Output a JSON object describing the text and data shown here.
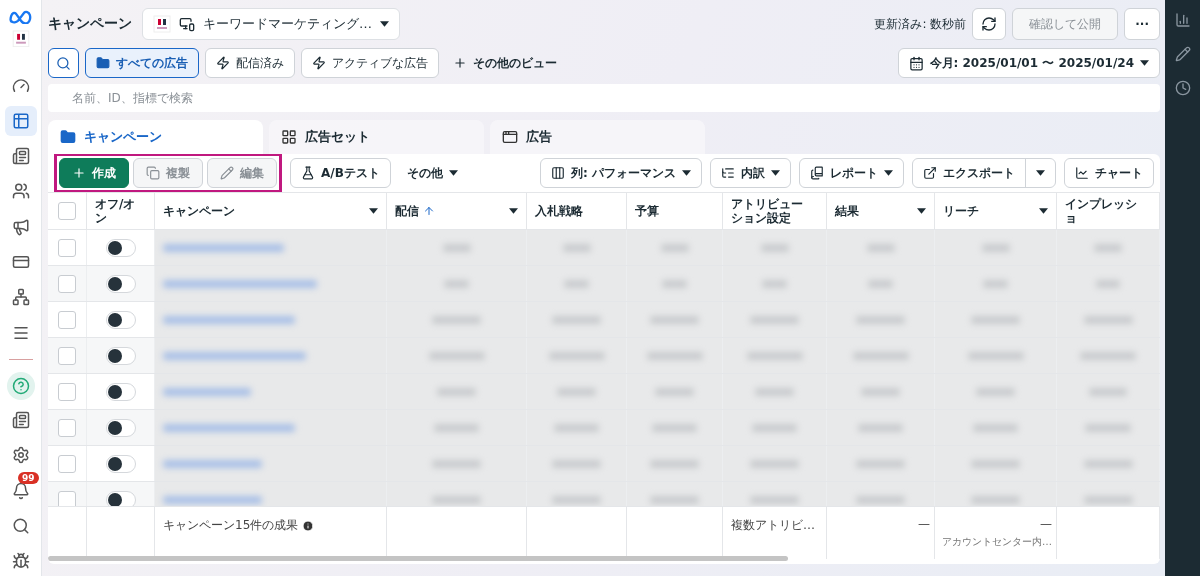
{
  "nav": {
    "items": [
      {
        "selected": false
      },
      {
        "selected": true
      },
      {
        "selected": false
      },
      {
        "selected": false
      },
      {
        "selected": false
      },
      {
        "selected": false
      },
      {
        "selected": false
      },
      {
        "selected": false
      }
    ],
    "bottom": [
      {
        "selected": false
      },
      {
        "selected": false
      },
      {
        "selected": false
      },
      {
        "selected": false
      },
      {
        "selected": false
      },
      {
        "selected": false
      }
    ],
    "badge": "99"
  },
  "header": {
    "title": "キャンペーン",
    "account": "キーワードマーケティング…",
    "updated": "更新済み: 数秒前",
    "publish": {
      "label": "確認して公開",
      "disabled": true
    },
    "more": "···"
  },
  "views": [
    {
      "label": "すべての広告",
      "selected": true,
      "kind": "folder"
    },
    {
      "label": "配信済み",
      "selected": false,
      "kind": "bolt"
    },
    {
      "label": "アクティブな広告",
      "selected": false,
      "kind": "bolt"
    }
  ],
  "more_views": "その他のビュー",
  "date_range": "今月: 2025/01/01 〜 2025/01/24",
  "search": {
    "placeholder": "名前、ID、指標で検索"
  },
  "tabs": [
    {
      "label": "キャンペーン",
      "selected": true
    },
    {
      "label": "広告セット",
      "selected": false
    },
    {
      "label": "広告",
      "selected": false
    }
  ],
  "actions": {
    "highlighted": true,
    "buttons": [
      {
        "label": "作成",
        "disabled": false,
        "primary": true
      },
      {
        "label": "複製",
        "disabled": true,
        "primary": false
      },
      {
        "label": "編集",
        "disabled": true,
        "primary": false
      }
    ]
  },
  "ab_test": "A/Bテスト",
  "other": "その他",
  "right_tools": [
    {
      "label": "列: パフォーマンス",
      "menu": true,
      "split": false
    },
    {
      "label": "内訳",
      "menu": true,
      "split": false
    },
    {
      "label": "レポート",
      "menu": true,
      "split": false
    },
    {
      "label": "エクスポート",
      "menu": true,
      "split": true
    },
    {
      "label": "チャート",
      "menu": false,
      "split": false
    }
  ],
  "table": {
    "columns": [
      {
        "kind": "checkbox",
        "checked": false
      },
      {
        "kind": "text",
        "label": "オフ/オン",
        "menu": false
      },
      {
        "kind": "text",
        "label": "キャンペーン",
        "menu": true
      },
      {
        "kind": "text",
        "label": "配信",
        "menu": true,
        "sorted_ascending": true
      },
      {
        "kind": "text",
        "label": "入札戦略",
        "menu": false
      },
      {
        "kind": "text",
        "label": "予算",
        "menu": false
      },
      {
        "kind": "text",
        "label": "アトリビューション設定",
        "menu": false
      },
      {
        "kind": "text",
        "label": "結果",
        "menu": true
      },
      {
        "kind": "text",
        "label": "リーチ",
        "menu": true
      },
      {
        "kind": "text",
        "label": "インプレッショ",
        "menu": false
      }
    ],
    "rows": [
      {
        "checked": false,
        "on": false
      },
      {
        "checked": false,
        "on": false
      },
      {
        "checked": false,
        "on": false
      },
      {
        "checked": false,
        "on": false
      },
      {
        "checked": false,
        "on": false
      },
      {
        "checked": false,
        "on": false
      },
      {
        "checked": false,
        "on": false
      },
      {
        "checked": false,
        "on": false
      }
    ],
    "footer": {
      "campaign": {
        "text": "キャンペーン15件の成果",
        "info": true
      },
      "attribution": {
        "text": "複数アトリビ…"
      },
      "results": {
        "text": "—"
      },
      "reach": {
        "text": "—",
        "sub": "アカウントセンター内…"
      }
    }
  }
}
